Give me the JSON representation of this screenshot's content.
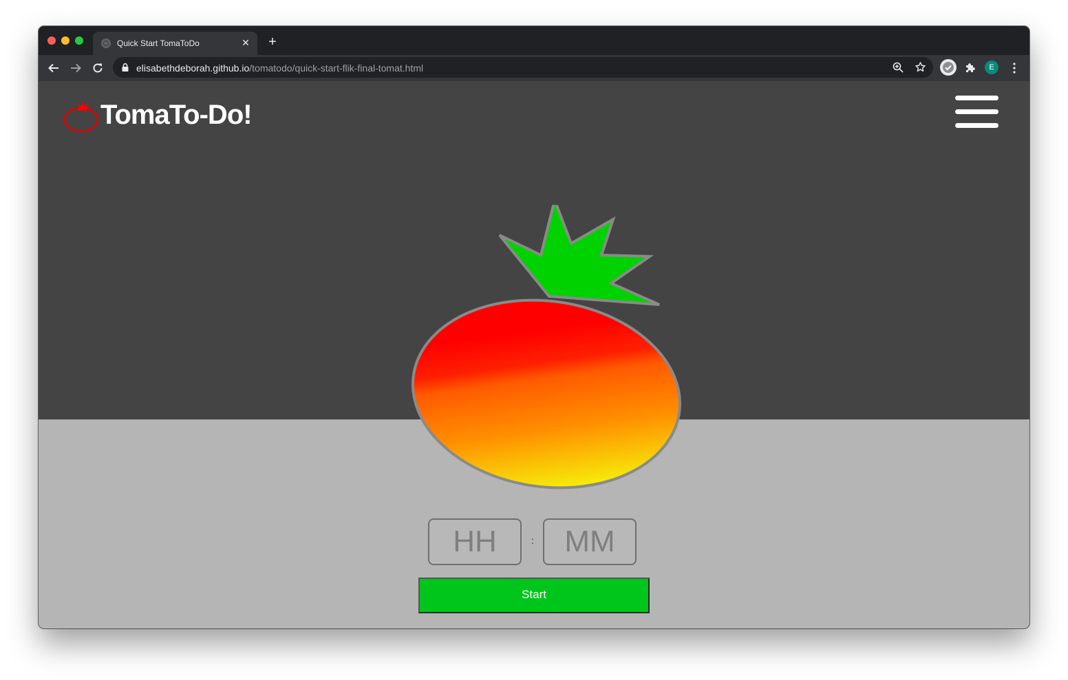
{
  "browser": {
    "tab_title": "Quick Start TomaToDo",
    "tab_close": "✕",
    "new_tab": "+",
    "url_host": "elisabethdeborah.github.io",
    "url_path": "/tomatodo/quick-start-flik-final-tomat.html",
    "profile_initial": "E"
  },
  "app": {
    "title": "TomaTo-Do!",
    "hours_placeholder": "HH",
    "minutes_placeholder": "MM",
    "separator": ":",
    "start_label": "Start"
  },
  "colors": {
    "page_dark": "#444444",
    "page_light": "#b5b5b5",
    "tomato_red": "#ff0000",
    "tomato_orange": "#ff7a00",
    "tomato_yellow": "#f5f00a",
    "leaf_green": "#00d200",
    "start_green": "#00c61c",
    "logo_red": "#e00000"
  },
  "icons": {
    "back": "arrow-left-icon",
    "forward": "arrow-right-icon",
    "reload": "reload-icon",
    "lock": "lock-icon",
    "zoom": "zoom-icon",
    "bookmark": "star-icon",
    "extension_check": "check-extension-icon",
    "extensions": "puzzle-icon",
    "menu": "kebab-menu-icon",
    "app_menu": "hamburger-menu-icon",
    "logo": "tomato-logo-icon"
  }
}
